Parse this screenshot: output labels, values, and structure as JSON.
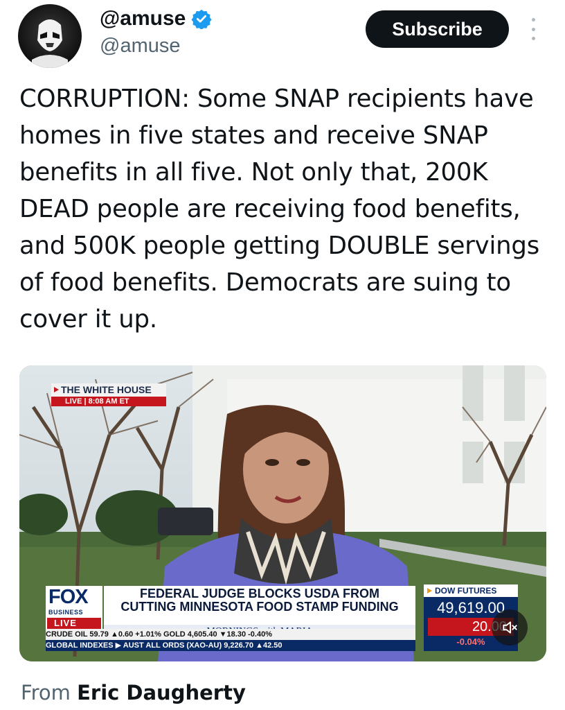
{
  "author": {
    "display_name": "@amuse",
    "handle": "@amuse",
    "verified_icon": "verified-badge-icon",
    "avatar_icon": "stormtrooper-avatar"
  },
  "actions": {
    "subscribe_label": "Subscribe",
    "more_icon": "more-vertical-icon"
  },
  "post": {
    "text": "CORRUPTION: Some SNAP recipients have homes in five states and receive SNAP benefits in all five. Not only that, 200K DEAD people are receiving food benefits, and 500K people getting DOUBLE servings of food benefits. Democrats are suing to cover it up."
  },
  "media": {
    "location": "THE WHITE HOUSE",
    "live_time": "LIVE  |  8:08 AM ET",
    "network": "FOX",
    "network_sub": "BUSINESS",
    "live_label": "LIVE",
    "headline_line1": "FEDERAL JUDGE BLOCKS USDA FROM",
    "headline_line2": "CUTTING MINNESOTA FOOD STAMP FUNDING",
    "show_name": "MORNINGS with MARIA",
    "ticker1": "CRUDE OIL   59.79 ▲0.60 +1.01% GOLD   4,605.40 ▼18.30 -0.40%",
    "ticker2": "GLOBAL INDEXES ▶  AUST ALL ORDS (XAO-AU) 9,226.70 ▲42.50",
    "dow_label": "DOW FUTURES",
    "dow_value": "49,619.00",
    "dow_change": "20.00",
    "dow_pct": "-0.04%",
    "mute_icon": "speaker-muted-icon"
  },
  "source": {
    "prefix": "From",
    "name": "Eric Daugherty"
  },
  "colors": {
    "accent_blue": "#1d9bf0",
    "text_primary": "#0f1419",
    "text_secondary": "#536471",
    "fox_red": "#c4161c",
    "fox_navy": "#0a2a66"
  }
}
